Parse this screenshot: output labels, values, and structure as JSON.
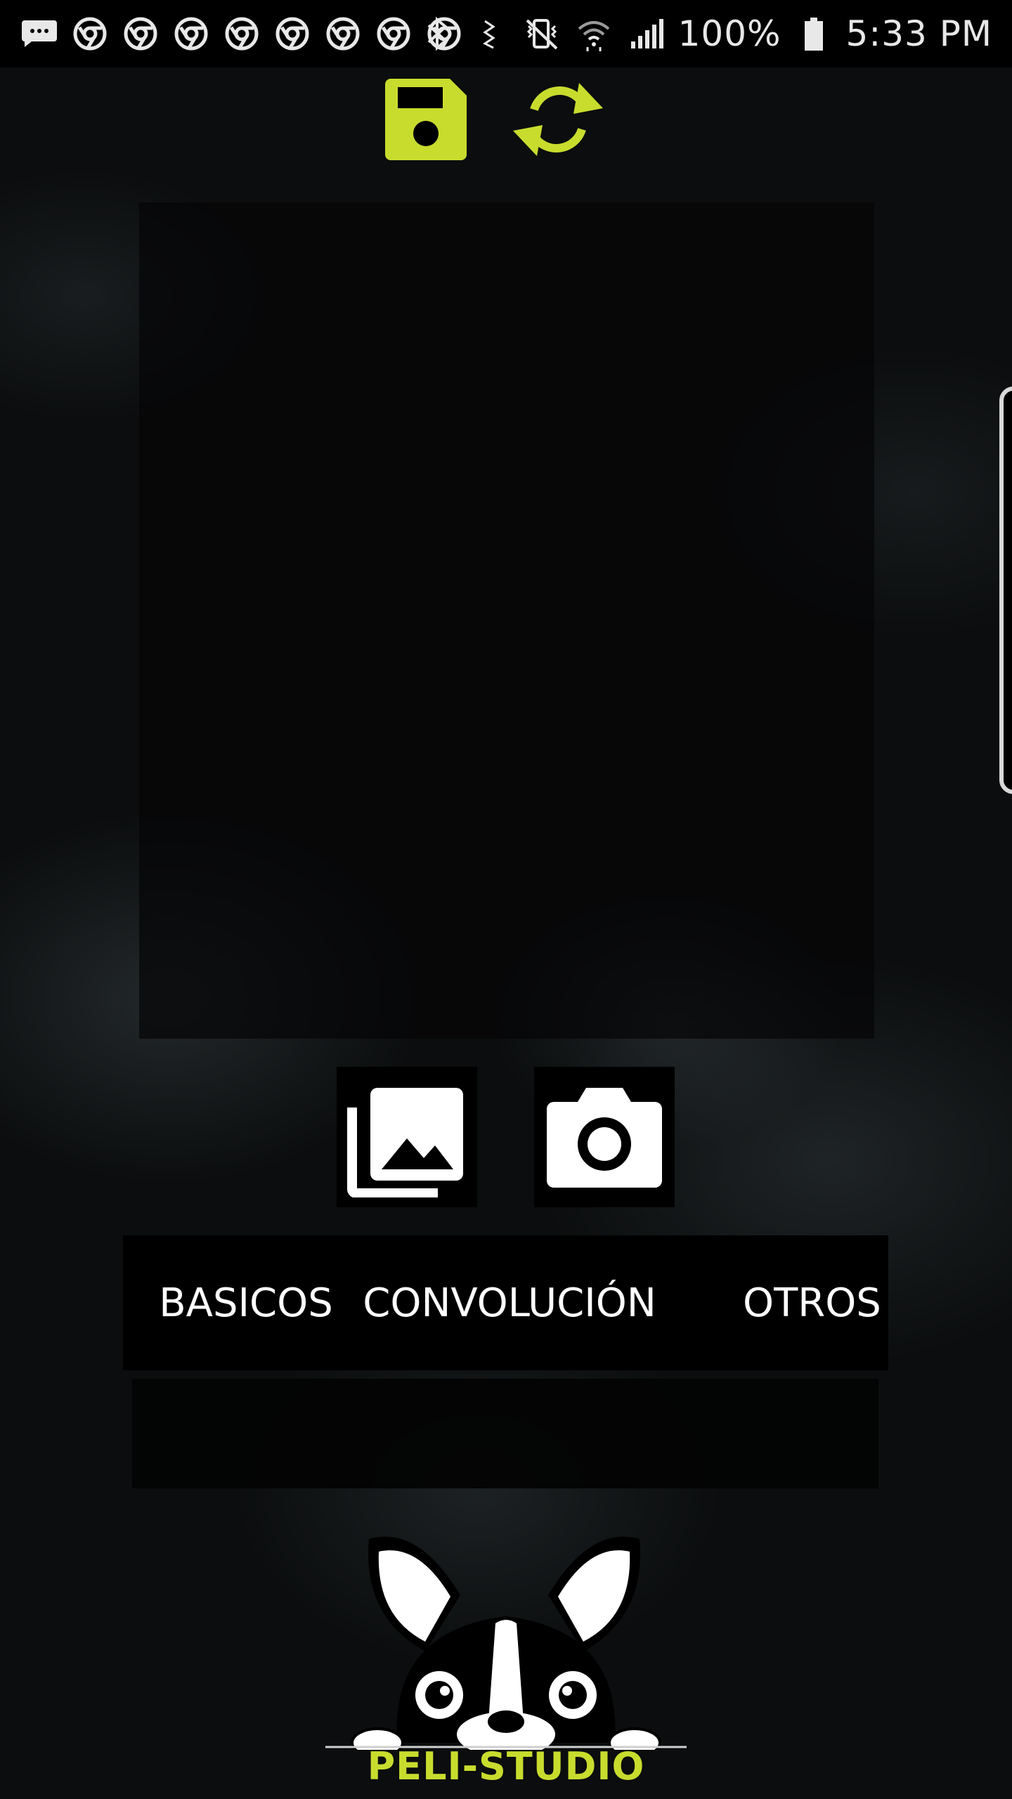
{
  "status_bar": {
    "battery": "100%",
    "time": "5:33 PM",
    "notification_icons": [
      "messaging-icon",
      "chrome-icon",
      "chrome-icon",
      "chrome-icon",
      "chrome-icon",
      "chrome-icon",
      "chrome-icon",
      "chrome-icon",
      "chrome-icon"
    ],
    "system_icons": [
      "bluetooth-icon",
      "nfc-icon",
      "vibrate-icon",
      "wifi-icon",
      "signal-icon",
      "battery-icon"
    ]
  },
  "toolbar": {
    "save_icon": "save-icon",
    "refresh_icon": "refresh-icon",
    "accent": "#c8dc2e"
  },
  "actions": {
    "gallery_icon": "photo-library-icon",
    "camera_icon": "camera-icon"
  },
  "tabs": [
    {
      "label": "BASICOS"
    },
    {
      "label": "CONVOLUCIÓN"
    },
    {
      "label": "OTROS"
    }
  ],
  "logo": {
    "text": "PELI-STUDIO",
    "icon": "french-bulldog-icon",
    "color": "#c8dc2e"
  }
}
